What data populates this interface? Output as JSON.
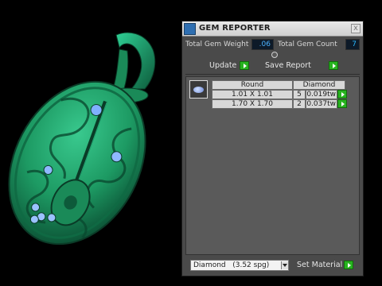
{
  "panel": {
    "title": "GEM REPORTER",
    "close_glyph": "x",
    "total_weight_label": "Total Gem Weight",
    "total_weight_value": ".06",
    "total_count_label": "Total Gem Count",
    "total_count_value": "7",
    "update_label": "Update",
    "save_report_label": "Save Report",
    "table": {
      "headers": [
        "Round",
        "Diamond"
      ],
      "rows": [
        {
          "size": "1.01 X 1.01",
          "qty": "5",
          "weight": "0.019tw"
        },
        {
          "size": "1.70 X 1.70",
          "qty": "2",
          "weight": "0.037tw"
        }
      ]
    },
    "material_selected": "Diamond   (3.52 spg)",
    "set_material_label": "Set Material"
  },
  "colors": {
    "pendant_green": "#23a86a",
    "panel_bg": "#4a4a4a",
    "accent_green": "#27b31f",
    "value_blue": "#4db3ff"
  },
  "icons": {
    "app": "gem-reporter-app-icon",
    "close": "close-icon",
    "action": "green-arrow-icon",
    "dropdown": "chevron-down-icon",
    "gem": "round-gem-icon"
  }
}
